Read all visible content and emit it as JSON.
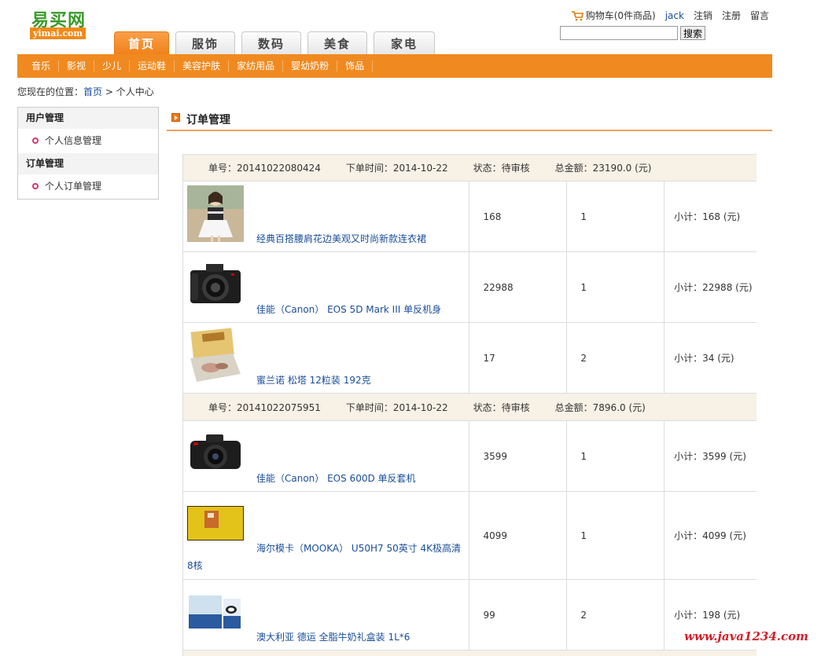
{
  "logo": {
    "cn": "易买网",
    "en": "yimai.com"
  },
  "topnav": [
    "首页",
    "服饰",
    "数码",
    "美食",
    "家电"
  ],
  "userbar": {
    "cart": "购物车(0件商品)",
    "user": "jack",
    "logout": "注销",
    "register": "注册",
    "message": "留言"
  },
  "search": {
    "value": "",
    "button": "搜索"
  },
  "categories": [
    "音乐",
    "影视",
    "少儿",
    "运动鞋",
    "美容护肤",
    "家纺用品",
    "婴幼奶粉",
    "饰品"
  ],
  "breadcrumb": {
    "prefix": "您现在的位置：",
    "home": "首页",
    "sep": " > ",
    "current": "个人中心"
  },
  "sidebar": {
    "groups": [
      {
        "title": "用户管理",
        "items": [
          "个人信息管理"
        ]
      },
      {
        "title": "订单管理",
        "items": [
          "个人订单管理"
        ]
      }
    ]
  },
  "main": {
    "title": "订单管理"
  },
  "orders": [
    {
      "no_label": "单号：20141022080424",
      "time_label": "下单时间：2014-10-22",
      "status_label": "状态：待审核",
      "total_label": "总金额：23190.0 (元)",
      "items": [
        {
          "name": "经典百搭腰肩花边美观又时尚新款连衣裙",
          "price": "168",
          "qty": "1",
          "subtotal": "小计：168 (元)"
        },
        {
          "name": "佳能（Canon） EOS 5D Mark III 单反机身",
          "price": "22988",
          "qty": "1",
          "subtotal": "小计：22988 (元)"
        },
        {
          "name": "蜜兰诺 松塔 12粒装 192克",
          "price": "17",
          "qty": "2",
          "subtotal": "小计：34 (元)"
        }
      ]
    },
    {
      "no_label": "单号：20141022075951",
      "time_label": "下单时间：2014-10-22",
      "status_label": "状态：待审核",
      "total_label": "总金额：7896.0 (元)",
      "items": [
        {
          "name": "佳能（Canon） EOS 600D 单反套机",
          "price": "3599",
          "qty": "1",
          "subtotal": "小计：3599 (元)"
        },
        {
          "name": "海尔模卡（MOOKA） U50H7 50英寸 4K极高清8核",
          "price": "4099",
          "qty": "1",
          "subtotal": "小计：4099 (元)"
        },
        {
          "name": "澳大利亚 德运 全脂牛奶礼盒装 1L*6",
          "price": "99",
          "qty": "2",
          "subtotal": "小计：198 (元)"
        }
      ]
    }
  ],
  "watermark": "www.java1234.com",
  "colors": {
    "accent": "#f08a20",
    "link": "#1a4d9a",
    "header_bg": "#f7f1e6"
  }
}
